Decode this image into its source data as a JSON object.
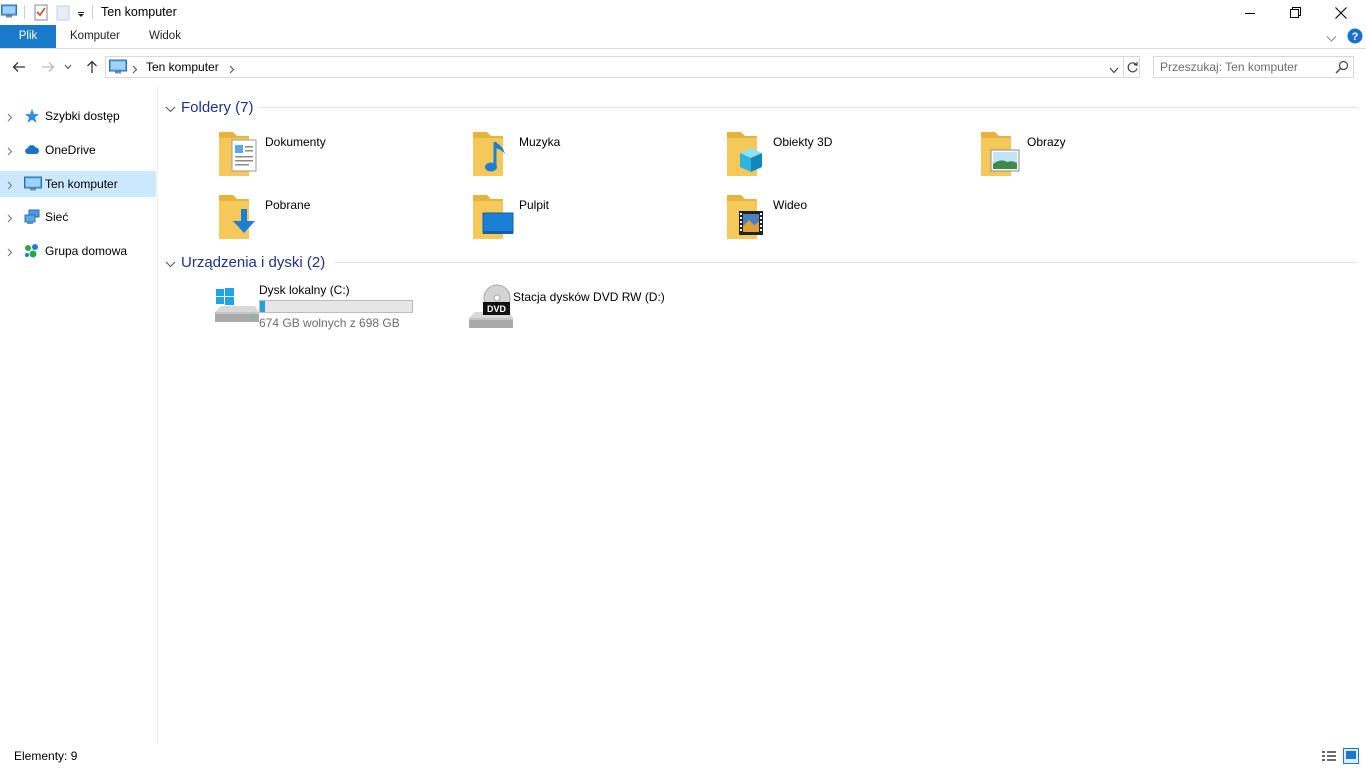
{
  "window": {
    "title": "Ten komputer"
  },
  "ribbon": {
    "tabs": [
      {
        "label": "Plik",
        "active": true
      },
      {
        "label": "Komputer"
      },
      {
        "label": "Widok"
      }
    ]
  },
  "address": {
    "breadcrumb": "Ten komputer",
    "search_placeholder": "Przeszukaj: Ten komputer"
  },
  "nav": {
    "items": [
      {
        "label": "Szybki dostęp",
        "icon": "star-icon"
      },
      {
        "label": "OneDrive",
        "icon": "cloud-icon"
      },
      {
        "label": "Ten komputer",
        "icon": "computer-icon",
        "selected": true
      },
      {
        "label": "Sieć",
        "icon": "network-icon"
      },
      {
        "label": "Grupa domowa",
        "icon": "homegroup-icon"
      }
    ]
  },
  "content": {
    "folders_group": {
      "title": "Foldery (7)",
      "items": [
        {
          "label": "Dokumenty",
          "icon": "documents-folder-icon"
        },
        {
          "label": "Muzyka",
          "icon": "music-folder-icon"
        },
        {
          "label": "Obiekty 3D",
          "icon": "3d-objects-folder-icon"
        },
        {
          "label": "Obrazy",
          "icon": "pictures-folder-icon"
        },
        {
          "label": "Pobrane",
          "icon": "downloads-folder-icon"
        },
        {
          "label": "Pulpit",
          "icon": "desktop-folder-icon"
        },
        {
          "label": "Wideo",
          "icon": "videos-folder-icon"
        }
      ]
    },
    "drives_group": {
      "title": "Urządzenia i dyski (2)",
      "items": [
        {
          "label": "Dysk lokalny (C:)",
          "subtitle": "674 GB wolnych z 698 GB",
          "used_fraction": 0.034,
          "icon": "local-disk-icon"
        },
        {
          "label": "Stacja dysków DVD RW (D:)",
          "icon": "dvd-drive-icon",
          "badge": "DVD"
        }
      ]
    }
  },
  "status": {
    "items_count": "Elementy: 9"
  },
  "colors": {
    "accent": "#1979ca",
    "group_title": "#1e3287",
    "selection": "#cce8ff",
    "folder": "#f5c85a",
    "progress": "#26a0da"
  }
}
